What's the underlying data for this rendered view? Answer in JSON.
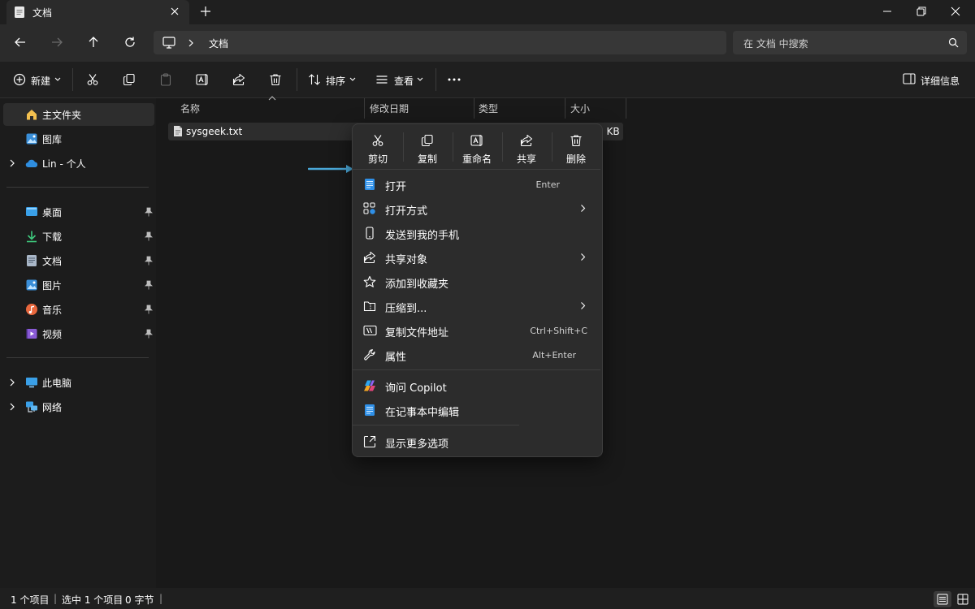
{
  "window": {
    "tab_title": "文档",
    "tab_icon": "document-icon"
  },
  "nav": {
    "breadcrumb": "文档",
    "search_placeholder": "在 文档 中搜索"
  },
  "toolbar": {
    "new_label": "新建",
    "sort_label": "排序",
    "view_label": "查看",
    "details_label": "详细信息"
  },
  "sidebar": {
    "home": "主文件夹",
    "gallery": "图库",
    "onedrive": "Lin - 个人",
    "pinned": [
      {
        "label": "桌面",
        "icon": "desktop-icon"
      },
      {
        "label": "下载",
        "icon": "download-icon"
      },
      {
        "label": "文档",
        "icon": "document-icon"
      },
      {
        "label": "图片",
        "icon": "pictures-icon"
      },
      {
        "label": "音乐",
        "icon": "music-icon"
      },
      {
        "label": "视频",
        "icon": "video-icon"
      }
    ],
    "this_pc": "此电脑",
    "network": "网络"
  },
  "files": {
    "columns": [
      "名称",
      "修改日期",
      "类型",
      "大小"
    ],
    "rows": [
      {
        "name": "sysgeek.txt",
        "size_visible": "0 KB"
      }
    ]
  },
  "context_menu": {
    "quick_actions": [
      {
        "label": "剪切",
        "icon": "cut-icon"
      },
      {
        "label": "复制",
        "icon": "copy-icon"
      },
      {
        "label": "重命名",
        "icon": "rename-icon"
      },
      {
        "label": "共享",
        "icon": "share-icon"
      },
      {
        "label": "删除",
        "icon": "delete-icon"
      }
    ],
    "items": [
      {
        "label": "打开",
        "shortcut": "Enter"
      },
      {
        "label": "打开方式",
        "submenu": true
      },
      {
        "label": "发送到我的手机"
      },
      {
        "label": "共享对象",
        "submenu": true
      },
      {
        "label": "添加到收藏夹"
      },
      {
        "label": "压缩到...",
        "submenu": true
      },
      {
        "label": "复制文件地址",
        "shortcut": "Ctrl+Shift+C"
      },
      {
        "label": "属性",
        "shortcut": "Alt+Enter"
      }
    ],
    "copilot_label": "询问 Copilot",
    "notepad_label": "在记事本中编辑",
    "more_label": "显示更多选项"
  },
  "status": {
    "count": "1 个项目",
    "selected": "选中 1 个项目",
    "bytes": "0 字节"
  },
  "colors": {
    "accent": "#4cc2ff",
    "menu_bg": "#2c2c2c",
    "window_bg": "#191919"
  }
}
